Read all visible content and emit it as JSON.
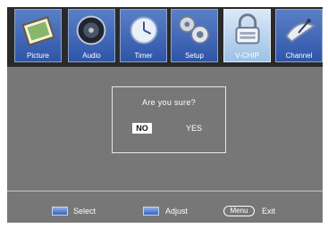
{
  "menu": {
    "items": [
      {
        "label": "Picture",
        "icon": "picture-icon"
      },
      {
        "label": "Audio",
        "icon": "speaker-icon"
      },
      {
        "label": "Timer",
        "icon": "clock-icon"
      },
      {
        "label": "Setup",
        "icon": "gears-icon"
      },
      {
        "label": "V-CHIP",
        "icon": "padlock-icon",
        "active": true
      },
      {
        "label": "Channel",
        "icon": "satellite-dish-icon"
      }
    ]
  },
  "dialog": {
    "question": "Are you sure?",
    "no_label": "NO",
    "yes_label": "YES",
    "selected": "NO"
  },
  "footer": {
    "select_label": "Select",
    "adjust_label": "Adjust",
    "menu_key": "Menu",
    "exit_label": "Exit"
  },
  "colors": {
    "background": "#777777",
    "menu_bar": "#2a2a2a",
    "menu_item": "#3a63b3",
    "active_item": "#b7d3ee"
  }
}
